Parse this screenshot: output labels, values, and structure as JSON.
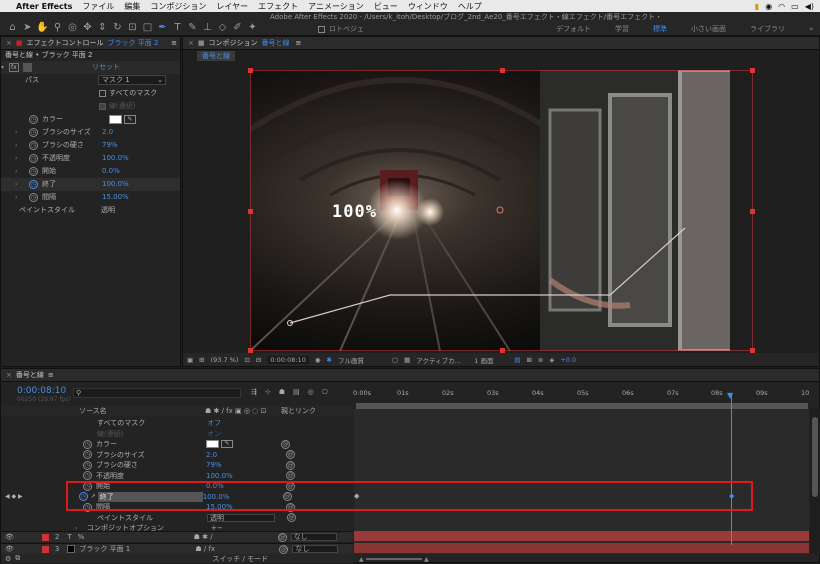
{
  "menubar": {
    "apple": "",
    "app": "After Effects",
    "items": [
      "ファイル",
      "編集",
      "コンポジション",
      "レイヤー",
      "エフェクト",
      "アニメーション",
      "ビュー",
      "ウィンドウ",
      "ヘルプ"
    ]
  },
  "window_title": "Adobe After Effects 2020 - /Users/k_itoh/Desktop/ブログ_2nd_Ae20_番号エフェクト・線エフェクト/番号エフェクト・線エフェクト.aep *",
  "toolbar": {
    "roto_label": "ロトベジェ",
    "workspaces": [
      "デフォルト",
      "学習",
      "標準",
      "小さい画面",
      "ライブラリ"
    ],
    "active_ws": "標準"
  },
  "effect_controls": {
    "tab_label": "エフェクトコントロール",
    "tab_layer": "ブラック 平面 2",
    "breadcrumb": "番号と線 • ブラック 平面 2",
    "reset": "リセット",
    "path_label": "パス",
    "path_value": "マスク 1",
    "all_masks": "すべてのマスク",
    "stroke_seq": "線(連続)",
    "rows": [
      {
        "label": "カラー"
      },
      {
        "label": "ブラシのサイズ",
        "value": "2.0"
      },
      {
        "label": "ブラシの硬さ",
        "value": "79%"
      },
      {
        "label": "不透明度",
        "value": "100.0%"
      },
      {
        "label": "開始",
        "value": "0.0%"
      },
      {
        "label": "終了",
        "value": "100.0%"
      },
      {
        "label": "間隔",
        "value": "15.00%"
      },
      {
        "label": "ペイントスタイル",
        "value": "透明"
      }
    ]
  },
  "composition": {
    "tab_label": "コンポジション",
    "tab_name": "番号と線",
    "sub_tab": "番号と線",
    "overlay_text": "100%",
    "footer": {
      "zoom": "(93.7 %)",
      "time": "0:00:08:10",
      "quality": "フル画質",
      "camera": "アクティブカ...",
      "views": "1 画面",
      "exposure": "+0.0"
    }
  },
  "timeline": {
    "tab_label": "番号と線",
    "timecode": "0:00:08:10",
    "frames": "00250 (29.97 fps)",
    "col_source": "ソース名",
    "col_parent": "親とリンク",
    "ruler": [
      "0:00s",
      "01s",
      "02s",
      "03s",
      "04s",
      "05s",
      "06s",
      "07s",
      "08s",
      "09s",
      "10"
    ],
    "rows": [
      {
        "name": "すべてのマスク",
        "value": "オフ"
      },
      {
        "name": "線(連続)",
        "value": "オン"
      },
      {
        "name": "カラー",
        "value": ""
      },
      {
        "name": "ブラシのサイズ",
        "value": "2.0"
      },
      {
        "name": "ブラシの硬さ",
        "value": "79%"
      },
      {
        "name": "不透明度",
        "value": "100.0%"
      },
      {
        "name": "開始",
        "value": "0.0%"
      },
      {
        "name": "終了",
        "value": "100.0%"
      },
      {
        "name": "間隔",
        "value": "15.00%"
      },
      {
        "name": "ペイントスタイル",
        "value": "透明"
      },
      {
        "name": "コンポジットオプション",
        "value": "+−"
      }
    ],
    "layers": [
      {
        "num": "2",
        "name": "%",
        "parent": "なし"
      },
      {
        "num": "3",
        "name": "ブラック 平面 1",
        "parent": "なし"
      }
    ],
    "footer": "スイッチ / モード"
  }
}
